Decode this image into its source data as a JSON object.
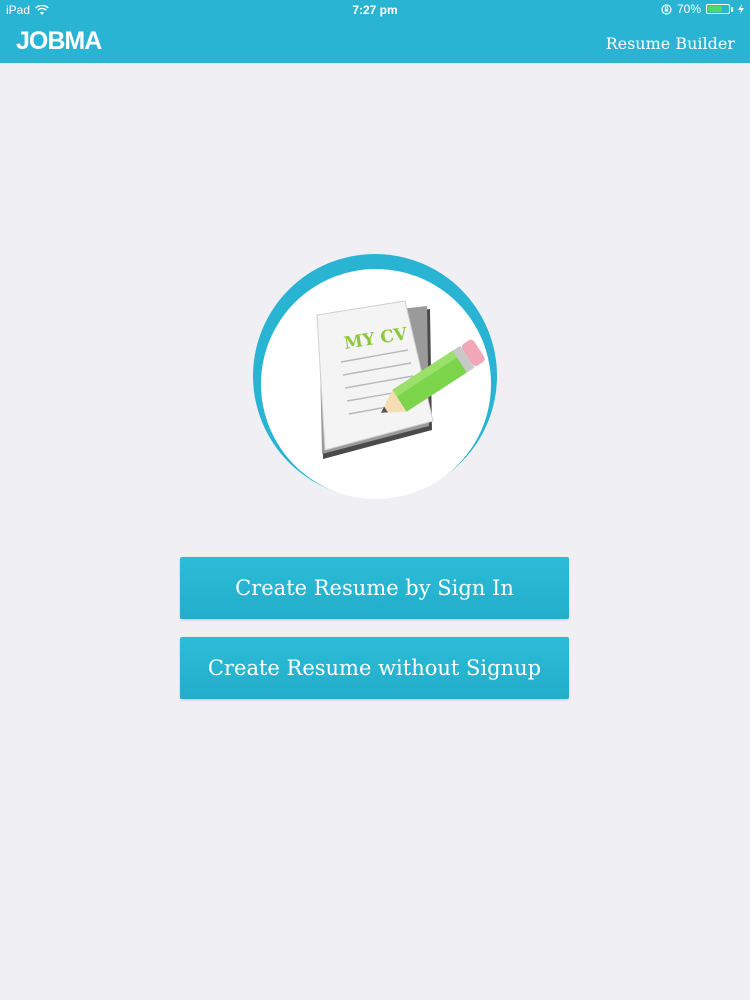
{
  "status_bar": {
    "device": "iPad",
    "time": "7:27 pm",
    "battery_percent": "70%",
    "battery_level": 0.7
  },
  "nav": {
    "logo": "JOBMA",
    "title": "Resume Builder"
  },
  "hero": {
    "cv_label": "MY CV"
  },
  "buttons": {
    "sign_in": "Create Resume by Sign In",
    "without_signup": "Create Resume without Signup"
  },
  "colors": {
    "accent": "#29b4d3",
    "background": "#efeff4",
    "cv_text": "#8dc63f",
    "pencil": "#7bd44a"
  }
}
